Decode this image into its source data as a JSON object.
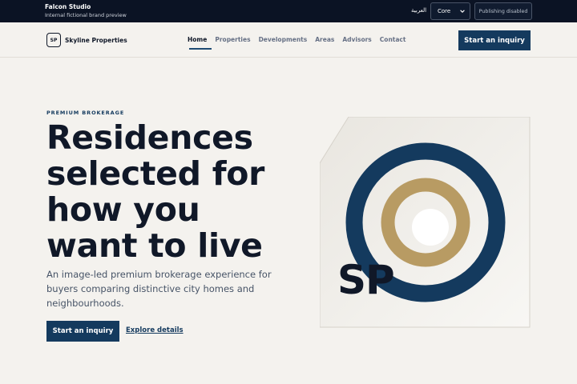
{
  "studio": {
    "name": "Falcon Studio",
    "subtitle": "Internal fictional brand preview",
    "language_link": "العربية",
    "theme_select": {
      "selected": "Core"
    },
    "publish_label": "Publishing disabled"
  },
  "site": {
    "logo_initials": "SP",
    "brand_name": "Skyline Properties",
    "nav": [
      {
        "label": "Home",
        "active": true
      },
      {
        "label": "Properties"
      },
      {
        "label": "Developments"
      },
      {
        "label": "Areas"
      },
      {
        "label": "Advisors"
      },
      {
        "label": "Contact"
      }
    ],
    "header_cta": "Start an inquiry"
  },
  "hero": {
    "eyebrow": "PREMIUM BROKERAGE",
    "title": "Residences selected for how you want to live",
    "lead": "An image-led premium brokerage experience for buyers comparing distinctive city homes and neighbourhoods.",
    "primary_cta": "Start an inquiry",
    "secondary_link": "Explore details",
    "art_initials": "SP"
  },
  "colors": {
    "navy": "#143a5e",
    "gold": "#b89b63",
    "background": "#f4f2ee",
    "studio_bar": "#0b1324"
  },
  "icons": {
    "select_chevron": "chevron-down-icon"
  }
}
